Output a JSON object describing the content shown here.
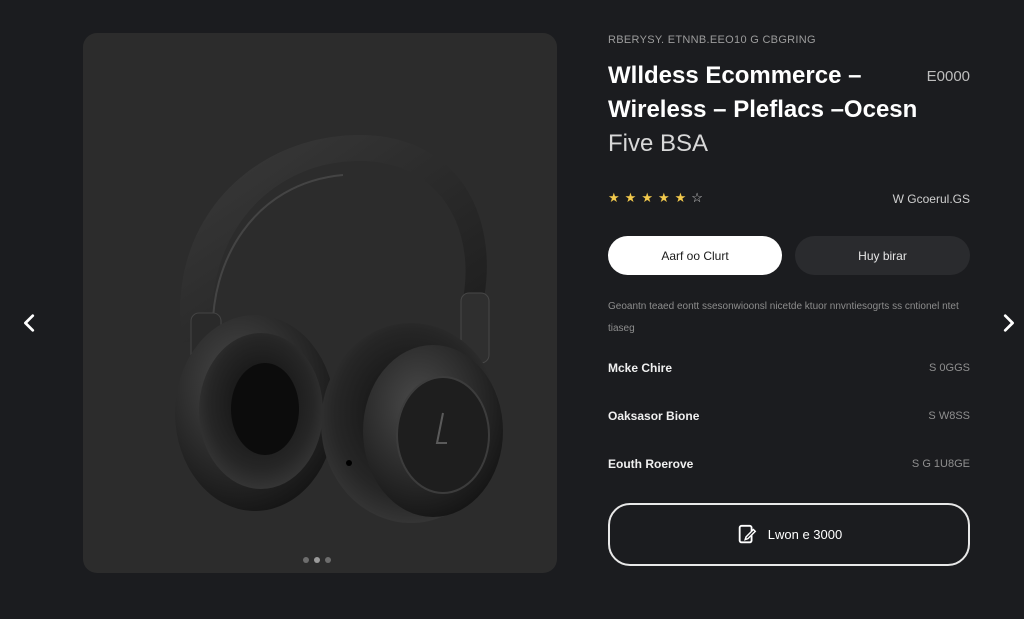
{
  "breadcrumb": "RBERYSY. ETNNB.EEO10 G CBGRING",
  "title": {
    "line1": "Wlldess Ecommerce –",
    "line2": "Wireless –  Pleflacs  –Ocesn",
    "line3": "Five BSA"
  },
  "price_top": "E0000",
  "rating": {
    "stars": 5,
    "filled": 5,
    "reviews_label": "W Gcoerul.GS"
  },
  "buttons": {
    "add_to_cart": "Aarf oo Clurt",
    "buy_now": "Huy birar"
  },
  "description": "Geoantn teaed eontt ssesonwioonsl nicetde ktuor nnvntiesogrts ss cntionel ntet tiaseg",
  "specs": [
    {
      "name": "Mcke Chire",
      "value": "S 0GGS"
    },
    {
      "name": "Oaksasor Bione",
      "value": "S W8SS"
    },
    {
      "name": "Eouth Roerove",
      "value": "S G 1U8GE"
    }
  ],
  "outline_button": {
    "label": "Lwon e 3000",
    "icon": "document-edit-icon"
  },
  "gallery": {
    "total": 3,
    "active_index": 2
  },
  "colors": {
    "background": "#1b1c1f",
    "panel": "#2c2c2c",
    "star": "#f2c94c",
    "accent": "#ffffff"
  }
}
